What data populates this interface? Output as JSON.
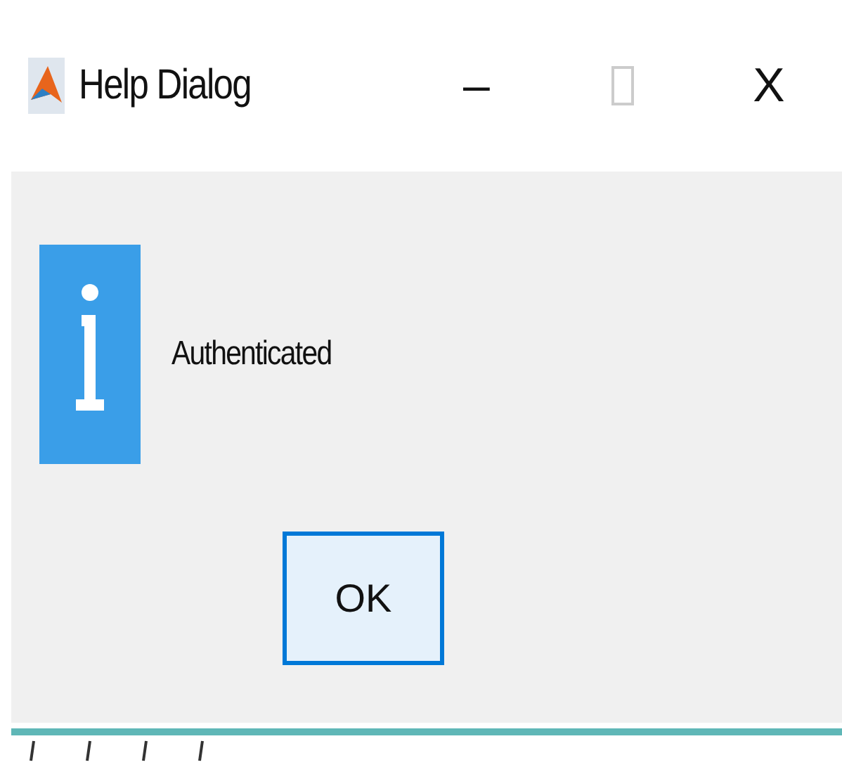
{
  "window": {
    "title": "Help Dialog",
    "controls": [
      {
        "kind": "minimize",
        "label": "–",
        "disabled": false
      },
      {
        "kind": "maximize",
        "disabled": true
      },
      {
        "kind": "close",
        "label": "X",
        "disabled": false
      }
    ]
  },
  "message": "Authenticated",
  "buttons": [
    {
      "label": "OK",
      "selected": true
    }
  ]
}
